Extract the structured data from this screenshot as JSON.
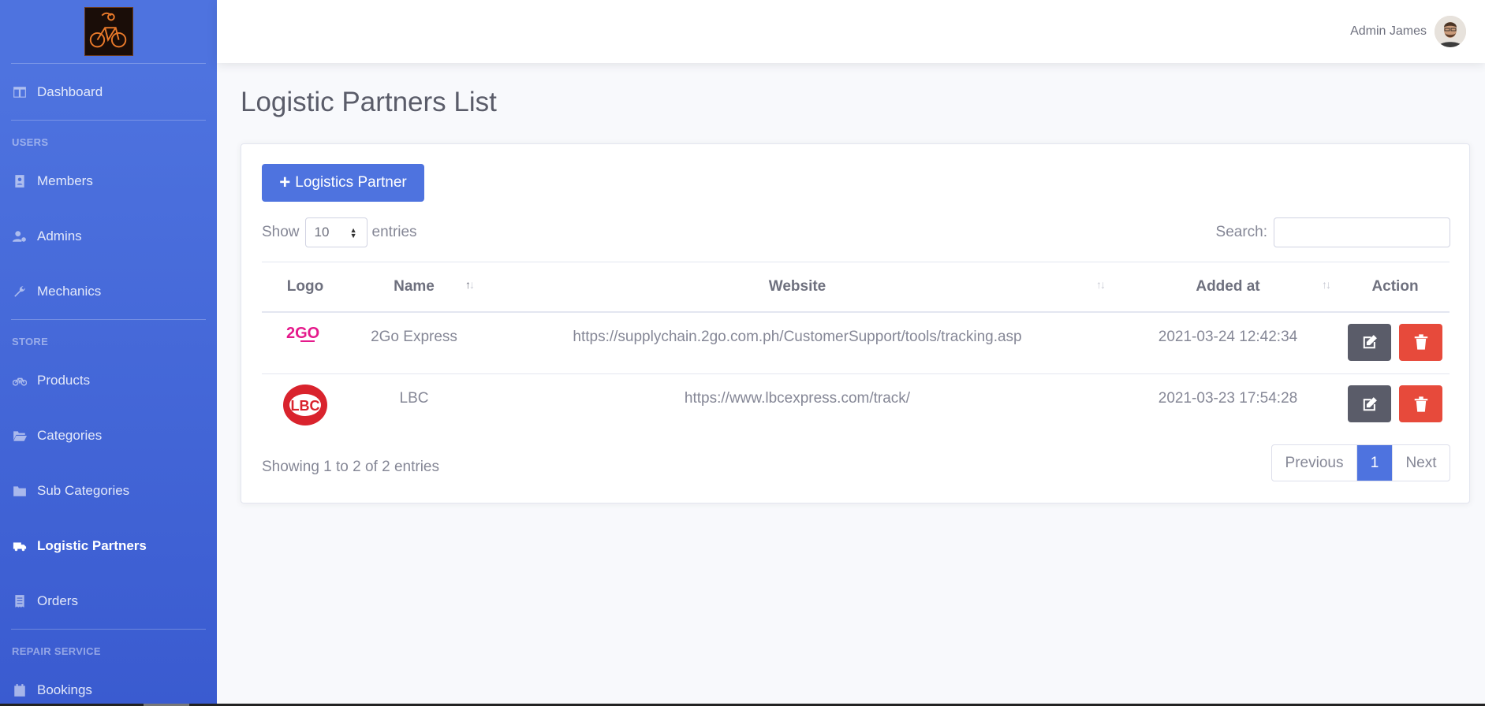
{
  "sidebar": {
    "items": [
      {
        "label": "Dashboard"
      },
      {
        "heading": "USERS"
      },
      {
        "label": "Members"
      },
      {
        "label": "Admins"
      },
      {
        "label": "Mechanics"
      },
      {
        "heading": "STORE"
      },
      {
        "label": "Products"
      },
      {
        "label": "Categories"
      },
      {
        "label": "Sub Categories"
      },
      {
        "label": "Logistic Partners"
      },
      {
        "label": "Orders"
      },
      {
        "heading": "REPAIR SERVICE"
      },
      {
        "label": "Bookings"
      }
    ]
  },
  "topbar": {
    "user_name": "Admin James"
  },
  "page": {
    "title": "Logistic Partners List"
  },
  "card": {
    "add_button": "Logistics Partner",
    "show_label": "Show",
    "page_size": "10",
    "entries_label": "entries",
    "search_label": "Search:",
    "search_value": ""
  },
  "table": {
    "headers": [
      "Logo",
      "Name",
      "Website",
      "Added at",
      "Action"
    ],
    "rows": [
      {
        "logo": "2GO",
        "name": "2Go Express",
        "website": "https://supplychain.2go.com.ph/CustomerSupport/tools/tracking.asp",
        "added_at": "2021-03-24 12:42:34"
      },
      {
        "logo": "LBC",
        "name": "LBC",
        "website": "https://www.lbcexpress.com/track/",
        "added_at": "2021-03-23 17:54:28"
      }
    ]
  },
  "footer": {
    "info": "Showing 1 to 2 of 2 entries",
    "previous": "Previous",
    "current_page": "1",
    "next": "Next"
  },
  "colors": {
    "primary": "#4e73df",
    "danger": "#e74a3b",
    "dark": "#5a5c69"
  }
}
